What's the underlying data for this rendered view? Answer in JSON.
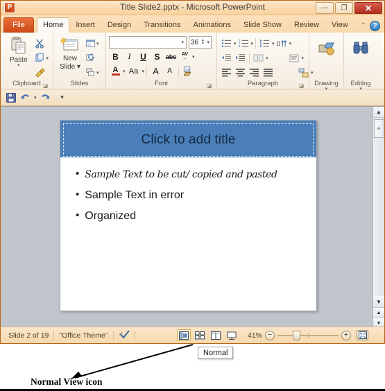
{
  "window": {
    "title": "Title Slide2.pptx  -  Microsoft PowerPoint",
    "logo_text": "P",
    "buttons": {
      "minimize": "—",
      "restore": "❐",
      "close": "✕"
    }
  },
  "tabs": {
    "file": "File",
    "items": [
      {
        "label": "Home",
        "active": true
      },
      {
        "label": "Insert",
        "active": false
      },
      {
        "label": "Design",
        "active": false
      },
      {
        "label": "Transitions",
        "active": false
      },
      {
        "label": "Animations",
        "active": false
      },
      {
        "label": "Slide Show",
        "active": false
      },
      {
        "label": "Review",
        "active": false
      },
      {
        "label": "View",
        "active": false
      }
    ],
    "minimize_ribbon": "⌃",
    "help": "?"
  },
  "ribbon": {
    "clipboard": {
      "label": "Clipboard",
      "paste_label": "Paste",
      "paste_carat": "▾",
      "cut_name": "Cut",
      "copy_name": "Copy",
      "copy_carat": "▾",
      "format_painter_name": "Format Painter",
      "launcher": "◪"
    },
    "slides": {
      "label": "Slides",
      "new_slide_label": "New\nSlide",
      "new_slide_line1": "New",
      "new_slide_line2": "Slide ▾",
      "layout_name": "Layout",
      "layout_carat": "▾",
      "reset_name": "Reset",
      "section_name": "Section",
      "section_carat": "▾"
    },
    "font": {
      "label": "Font",
      "font_name_value": "",
      "font_name_carat": "▾",
      "font_size_value": "36",
      "font_size_carat": "▾",
      "bold": "B",
      "italic": "I",
      "underline": "U",
      "shadow": "S",
      "strikethrough": "abc",
      "char_spacing": "AV",
      "char_spacing_carat": "▾",
      "font_color": "A",
      "font_color_carat": "▾",
      "change_case": "Aa",
      "change_case_carat": "▾",
      "grow_font": "A",
      "shrink_font": "A",
      "clear_formatting": "A",
      "launcher": "◪"
    },
    "paragraph": {
      "label": "Paragraph",
      "bullets_carat": "▾",
      "numbering_carat": "▾",
      "line_spacing_carat": "▾",
      "text_direction_carat": "▾",
      "columns_carat": "▾",
      "align_text_carat": "▾",
      "smartart_carat": "▾",
      "launcher": "◪"
    },
    "drawing": {
      "label": "Drawing",
      "carat": "▾"
    },
    "editing": {
      "label": "Editing",
      "carat": "▾"
    }
  },
  "quick_access": {
    "save": "Save",
    "undo": "Undo",
    "undo_carat": "▾",
    "redo": "Redo",
    "customize_carat": "▾"
  },
  "slide": {
    "title_placeholder": "Click to add title",
    "bullets": [
      {
        "dot": "•",
        "text": "Sample Text to be cut/ copied and pasted",
        "style": "script"
      },
      {
        "dot": "•",
        "text": "Sample Text in error",
        "style": "normal"
      },
      {
        "dot": "•",
        "text": "Organized",
        "style": "normal"
      }
    ],
    "title_band_color": "#4a7fba"
  },
  "scrollbar": {
    "up": "▲",
    "thumb_grip": "≡",
    "down": "▼",
    "prev_slide": "▲",
    "next_slide": "▼"
  },
  "status_bar": {
    "slide_counter": "Slide 2 of 19",
    "theme": "\"Office Theme\"",
    "spellcheck_name": "spell-check",
    "views": [
      {
        "name": "normal-view",
        "selected": true
      },
      {
        "name": "slide-sorter-view",
        "selected": false
      },
      {
        "name": "reading-view",
        "selected": false
      },
      {
        "name": "slide-show-view",
        "selected": false
      }
    ],
    "zoom_out": "−",
    "zoom_level": "41%",
    "zoom_in": "+",
    "fit_to_window": "⛶",
    "grip": "⋰"
  },
  "tooltip": {
    "text": "Normal"
  },
  "annotation": {
    "label": "Normal View icon"
  }
}
